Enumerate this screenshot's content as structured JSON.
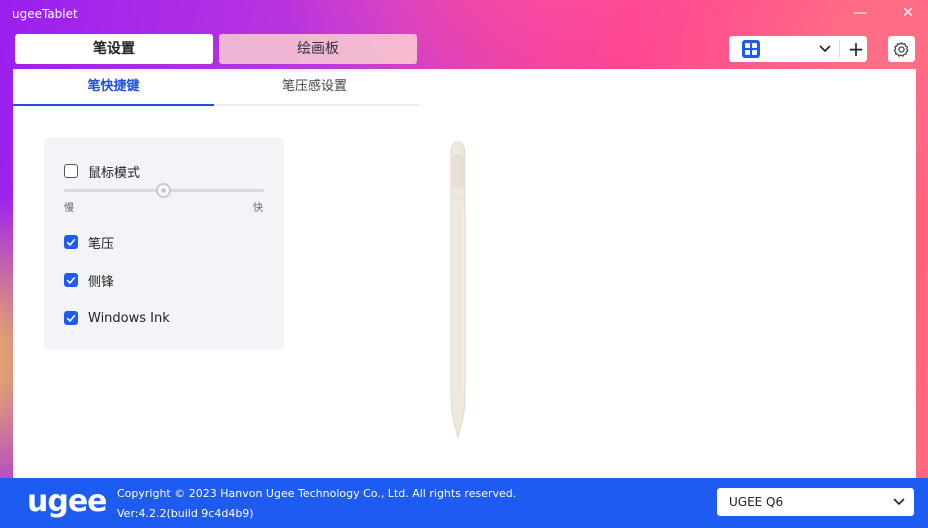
{
  "window": {
    "title": "ugeeTablet",
    "minimize": "—",
    "close": "✕"
  },
  "main_tabs": [
    {
      "label": "笔设置",
      "active": true
    },
    {
      "label": "绘画板",
      "active": false
    }
  ],
  "toolbar": {
    "device_selector_icon": "grid-icon",
    "add_label": "+",
    "settings_icon": "gear-icon"
  },
  "sub_tabs": [
    {
      "label": "笔快捷键",
      "active": true
    },
    {
      "label": "笔压感设置",
      "active": false
    }
  ],
  "pen_panel": {
    "mouse_mode": {
      "label": "鼠标模式",
      "checked": false
    },
    "speed_slider": {
      "min_label": "慢",
      "max_label": "快",
      "value_fraction": 0.5
    },
    "options": [
      {
        "label": "笔压",
        "checked": true
      },
      {
        "label": "侧锋",
        "checked": true
      },
      {
        "label": "Windows Ink",
        "checked": true
      }
    ]
  },
  "footer": {
    "logo": "ugee",
    "copyright": "Copyright © 2023 Hanvon Ugee Technology Co., Ltd. All rights reserved.",
    "version": "Ver:4.2.2(build 9c4d4b9)",
    "model_select": "UGEE Q6"
  },
  "colors": {
    "accent": "#1e5bf0",
    "active_tab_text": "#1e4fd8",
    "footer_bg": "#1e5bf0",
    "pen_color": "#efe8dc"
  }
}
